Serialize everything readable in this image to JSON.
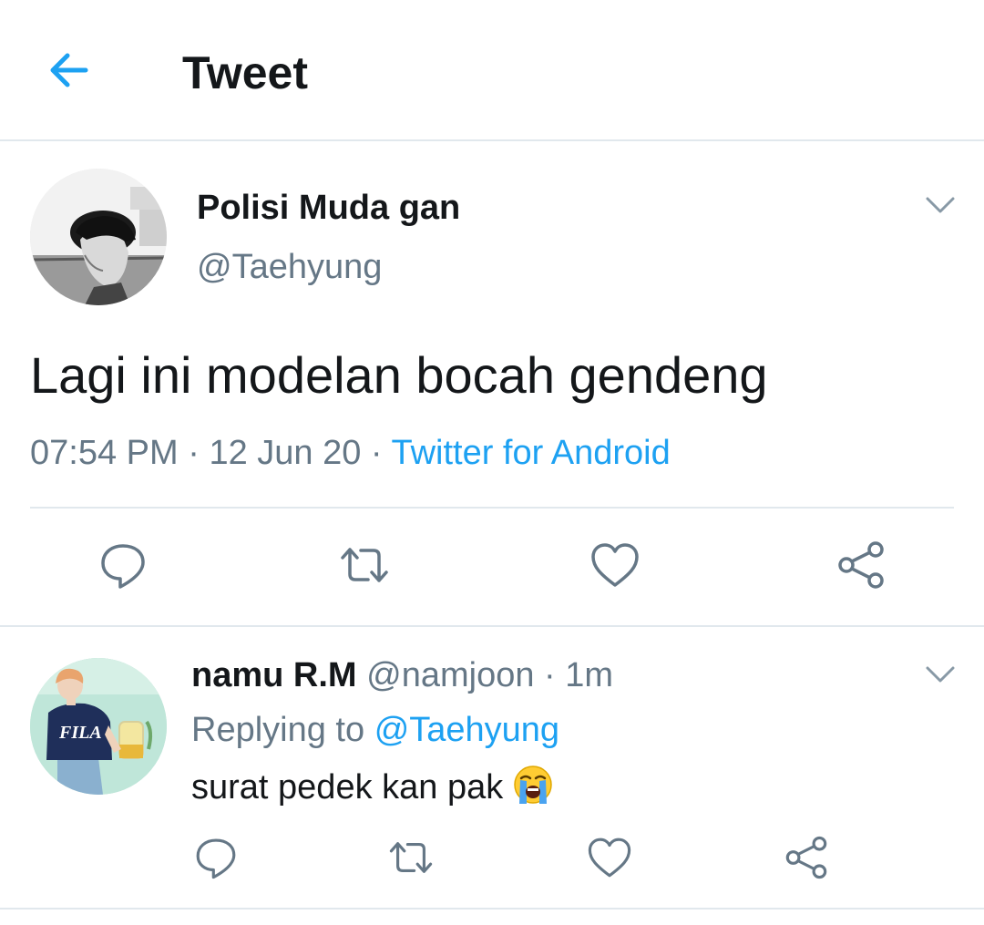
{
  "header": {
    "title": "Tweet",
    "back_icon": "arrow-left-icon"
  },
  "tweet": {
    "author_name": "Polisi Muda gan",
    "author_handle": "@Taehyung",
    "text": "Lagi ini modelan bocah gendeng",
    "time": "07:54 PM",
    "date": "12 Jun 20",
    "separator": " · ",
    "source": "Twitter for Android"
  },
  "reply": {
    "author_name": "namu R.M",
    "author_handle": "@namjoon",
    "age": "1m",
    "replying_label": "Replying to",
    "replying_handle": "@Taehyung",
    "text": "surat pedek kan pak",
    "emoji": "loudly-crying-face"
  },
  "actions": [
    "reply-icon",
    "retweet-icon",
    "like-icon",
    "share-icon"
  ],
  "colors": {
    "accent": "#1da1f2",
    "muted": "#657786",
    "text": "#14171a",
    "divider": "#e1e8ed"
  }
}
